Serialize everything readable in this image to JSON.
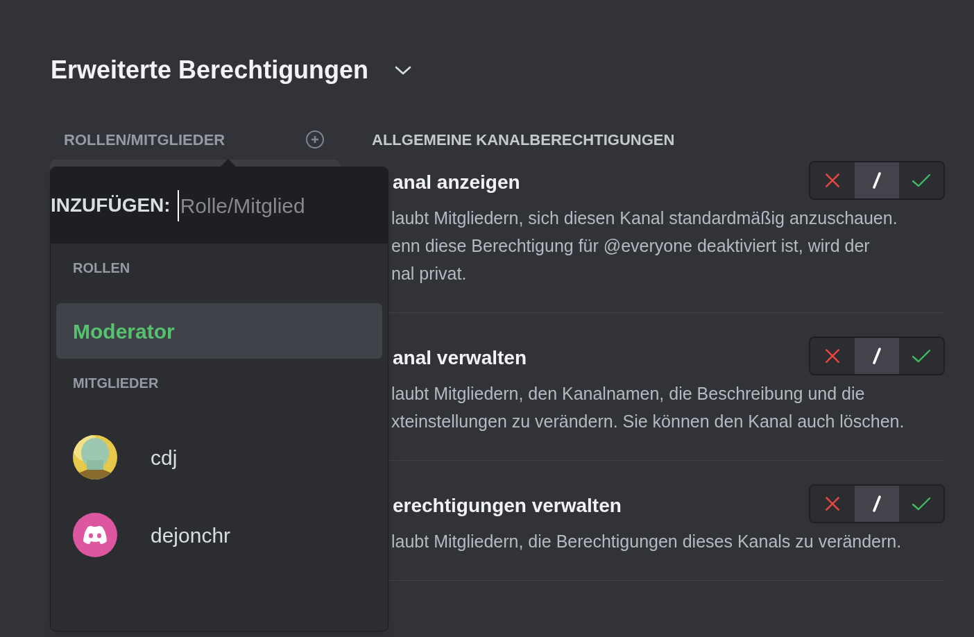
{
  "section": {
    "title": "Erweiterte Berechtigungen",
    "expanded": true
  },
  "roles_header": "ROLLEN/MITGLIEDER",
  "permissions_header": "ALLGEMEINE KANALBERECHTIGUNGEN",
  "popover": {
    "label": "INZUFÜGEN:",
    "placeholder": "Rolle/Mitglied",
    "groups": [
      {
        "heading": "ROLLEN",
        "items": [
          {
            "kind": "role",
            "name": "Moderator",
            "color": "#57c26e",
            "selected": true
          }
        ]
      },
      {
        "heading": "MITGLIEDER",
        "items": [
          {
            "kind": "member",
            "name": "cdj",
            "avatar_photo": true,
            "selected": false
          },
          {
            "kind": "member",
            "name": "dejonchr",
            "avatar_photo": false,
            "selected": false
          }
        ]
      }
    ]
  },
  "permissions": [
    {
      "title": "anal anzeigen",
      "description": [
        "laubt Mitgliedern, sich diesen Kanal standardmäßig anzuschauen.",
        "enn diese Berechtigung für @everyone deaktiviert ist, wird der",
        "nal privat."
      ],
      "options": [
        {
          "kind": "deny",
          "selected": false
        },
        {
          "kind": "neutral",
          "selected": true
        },
        {
          "kind": "allow",
          "selected": false
        }
      ]
    },
    {
      "title": "anal verwalten",
      "description": [
        "laubt Mitgliedern, den Kanalnamen, die Beschreibung und die",
        "xteinstellungen zu verändern. Sie können den Kanal auch löschen."
      ],
      "options": [
        {
          "kind": "deny",
          "selected": false
        },
        {
          "kind": "neutral",
          "selected": true
        },
        {
          "kind": "allow",
          "selected": false
        }
      ]
    },
    {
      "title": "erechtigungen verwalten",
      "description": [
        "laubt Mitgliedern, die Berechtigungen dieses Kanals zu verändern."
      ],
      "options": [
        {
          "kind": "deny",
          "selected": false
        },
        {
          "kind": "neutral",
          "selected": true
        },
        {
          "kind": "allow",
          "selected": false
        }
      ]
    }
  ]
}
